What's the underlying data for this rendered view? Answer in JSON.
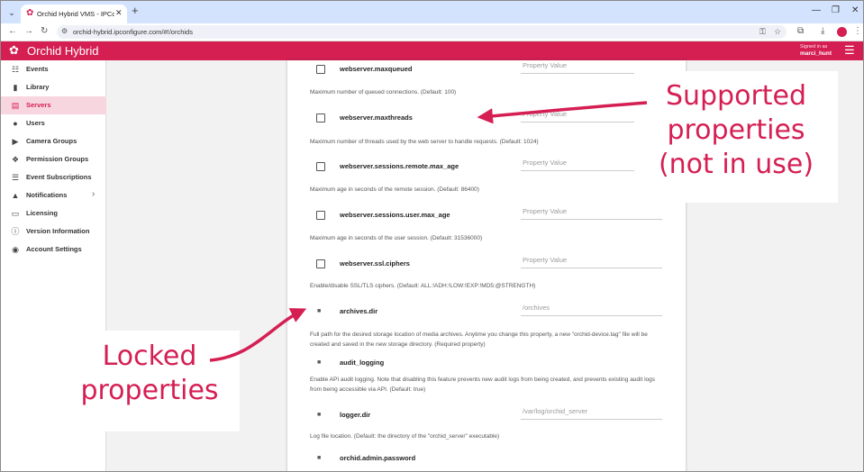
{
  "browser": {
    "tab_title": "Orchid Hybrid VMS - IPConfigure",
    "url": "orchid-hybrid.ipconfigure.com/#!/orchids"
  },
  "app": {
    "brand": "Orchid Hybrid",
    "signed_in_label": "Signed in as",
    "signed_in_user": "marci_hunt"
  },
  "sidebar": {
    "items": [
      {
        "label": "Events",
        "icon": "events-icon",
        "active": false
      },
      {
        "label": "Library",
        "icon": "bookmark-icon",
        "active": false
      },
      {
        "label": "Servers",
        "icon": "servers-icon",
        "active": true
      },
      {
        "label": "Users",
        "icon": "person-icon",
        "active": false
      },
      {
        "label": "Camera Groups",
        "icon": "camera-icon",
        "active": false
      },
      {
        "label": "Permission Groups",
        "icon": "people-icon",
        "active": false
      },
      {
        "label": "Event Subscriptions",
        "icon": "subscription-icon",
        "active": false
      },
      {
        "label": "Notifications",
        "icon": "bell-icon",
        "active": false
      },
      {
        "label": "Licensing",
        "icon": "license-icon",
        "active": false
      },
      {
        "label": "Version Information",
        "icon": "info-icon",
        "active": false
      },
      {
        "label": "Account Settings",
        "icon": "account-icon",
        "active": false
      }
    ]
  },
  "properties": [
    {
      "name": "webserver.maxqueued",
      "value_placeholder": "Property Value",
      "locked": false,
      "description": "Maximum number of queued connections. (Default: 100)"
    },
    {
      "name": "webserver.maxthreads",
      "value_placeholder": "Property Value",
      "locked": false,
      "description": "Maximum number of threads used by the web server to handle requests. (Default: 1024)"
    },
    {
      "name": "webserver.sessions.remote.max_age",
      "value_placeholder": "Property Value",
      "locked": false,
      "description": "Maximum age in seconds of the remote session. (Default: 86400)"
    },
    {
      "name": "webserver.sessions.user.max_age",
      "value_placeholder": "Property Value",
      "locked": false,
      "description": "Maximum age in seconds of the user session. (Default: 31536000)"
    },
    {
      "name": "webserver.ssl.ciphers",
      "value_placeholder": "Property Value",
      "locked": false,
      "description": "Enable/disable SSL/TLS ciphers. (Default: ALL:!ADH:!LOW:!EXP:!MD5:@STRENGTH)"
    },
    {
      "name": "archives.dir",
      "value": "/orchives",
      "locked": true,
      "description": "Full path for the desired storage location of media archives. Anytime you change this property, a new \"orchid-device.tag\" file will be created and saved in the new storage directory. (Required property)"
    },
    {
      "name": "audit_logging",
      "value": "",
      "locked": true,
      "description": "Enable API audit logging. Note that disabling this feature prevents new audit logs from being created, and prevents existing audit logs from being accessible via API. (Default: true)"
    },
    {
      "name": "logger.dir",
      "value": "/var/log/orchid_server",
      "locked": true,
      "description": "Log file location. (Default: the directory of the \"orchid_server\" executable)"
    },
    {
      "name": "orchid.admin.password",
      "value": "",
      "locked": true,
      "description": ""
    }
  ],
  "callouts": {
    "supported_line1": "Supported",
    "supported_line2": "properties",
    "supported_line3": "(not in use)",
    "locked_line1": "Locked",
    "locked_line2": "properties"
  },
  "colors": {
    "brand": "#d51f53",
    "sidebar_active_bg": "#f8d6e0"
  }
}
